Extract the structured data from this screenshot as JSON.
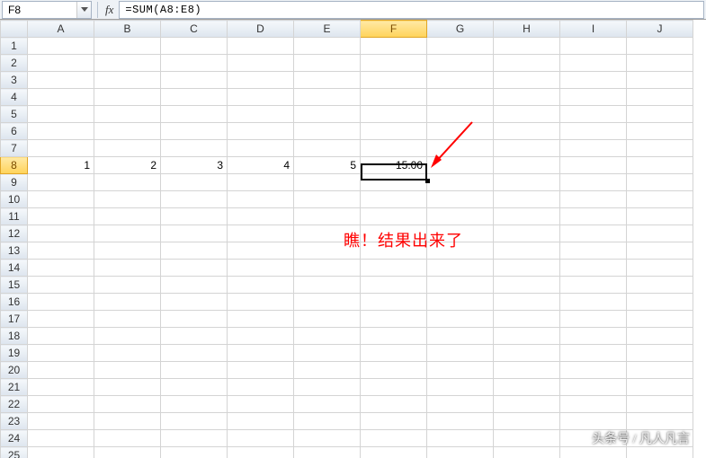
{
  "name_box": {
    "value": "F8"
  },
  "formula_bar": {
    "fx_label": "fx",
    "content": "=SUM(A8:E8)"
  },
  "columns": [
    "A",
    "B",
    "C",
    "D",
    "E",
    "F",
    "G",
    "H",
    "I",
    "J"
  ],
  "rows": [
    "1",
    "2",
    "3",
    "4",
    "5",
    "6",
    "7",
    "8",
    "9",
    "10",
    "11",
    "12",
    "13",
    "14",
    "15",
    "16",
    "17",
    "18",
    "19",
    "20",
    "21",
    "22",
    "23",
    "24",
    "25"
  ],
  "active": {
    "col": "F",
    "row": "8"
  },
  "cells": {
    "A8": "1",
    "B8": "2",
    "C8": "3",
    "D8": "4",
    "E8": "5",
    "F8": "15.00"
  },
  "annotation_text": "瞧！结果出来了",
  "watermark_text": "头条号 / 凡人凡言",
  "chart_data": {
    "type": "table",
    "title": "",
    "columns": [
      "A",
      "B",
      "C",
      "D",
      "E",
      "F"
    ],
    "rows": [
      {
        "row": 8,
        "A": 1,
        "B": 2,
        "C": 3,
        "D": 4,
        "E": 5,
        "F": 15.0
      }
    ],
    "formula": "F8 = SUM(A8:E8)"
  }
}
